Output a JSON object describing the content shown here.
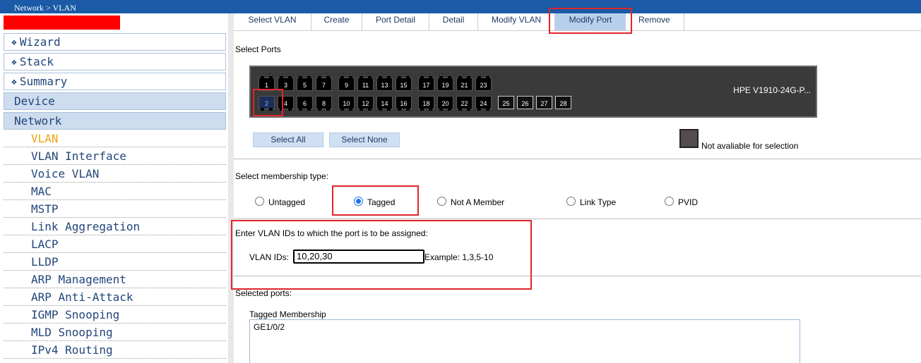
{
  "breadcrumb": "Network > VLAN",
  "sidebar": {
    "top_items": [
      {
        "label": "Wizard"
      },
      {
        "label": "Stack"
      },
      {
        "label": "Summary"
      }
    ],
    "sections": [
      {
        "label": "Device"
      },
      {
        "label": "Network"
      }
    ],
    "sub_items": [
      {
        "label": "VLAN",
        "active": true
      },
      {
        "label": "VLAN Interface"
      },
      {
        "label": "Voice VLAN"
      },
      {
        "label": "MAC"
      },
      {
        "label": "MSTP"
      },
      {
        "label": "Link Aggregation"
      },
      {
        "label": "LACP"
      },
      {
        "label": "LLDP"
      },
      {
        "label": "ARP Management"
      },
      {
        "label": "ARP Anti-Attack"
      },
      {
        "label": "IGMP Snooping"
      },
      {
        "label": "MLD Snooping"
      },
      {
        "label": "IPv4 Routing"
      }
    ]
  },
  "tabs": [
    {
      "label": "Select VLAN"
    },
    {
      "label": "Create"
    },
    {
      "label": "Port Detail"
    },
    {
      "label": "Detail"
    },
    {
      "label": "Modify VLAN"
    },
    {
      "label": "Modify Port",
      "selected": true
    },
    {
      "label": "Remove"
    }
  ],
  "select_ports": {
    "title": "Select Ports",
    "top_ports": [
      "1",
      "3",
      "5",
      "7",
      "9",
      "11",
      "13",
      "15",
      "17",
      "19",
      "21",
      "23"
    ],
    "bottom_ports": [
      "2",
      "4",
      "6",
      "8",
      "10",
      "12",
      "14",
      "16",
      "18",
      "20",
      "22",
      "24"
    ],
    "sfp_ports": [
      "25",
      "26",
      "27",
      "28"
    ],
    "selected_port": "2",
    "model": "HPE V1910-24G-P...",
    "select_all": "Select All",
    "select_none": "Select None",
    "legend": "Not avaliable for selection"
  },
  "membership": {
    "title": "Select membership type:",
    "options": [
      {
        "label": "Untagged",
        "checked": false
      },
      {
        "label": "Tagged",
        "checked": true
      },
      {
        "label": "Not A Member",
        "checked": false
      },
      {
        "label": "Link Type",
        "checked": false
      },
      {
        "label": "PVID",
        "checked": false
      }
    ]
  },
  "vlan_ids": {
    "prompt": "Enter VLAN IDs to which the port is to be assigned:",
    "label": "VLAN IDs:",
    "value": "10,20,30",
    "example": "Example: 1,3,5-10"
  },
  "selected_ports": {
    "title": "Selected ports:",
    "group_title": "Tagged Membership",
    "ports": "GE1/0/2"
  },
  "colors": {
    "topbar": "#1a5aa6",
    "highlight": "#e1252b",
    "tab_selected": "#b9d0ec",
    "active_nav": "#f0a010"
  }
}
